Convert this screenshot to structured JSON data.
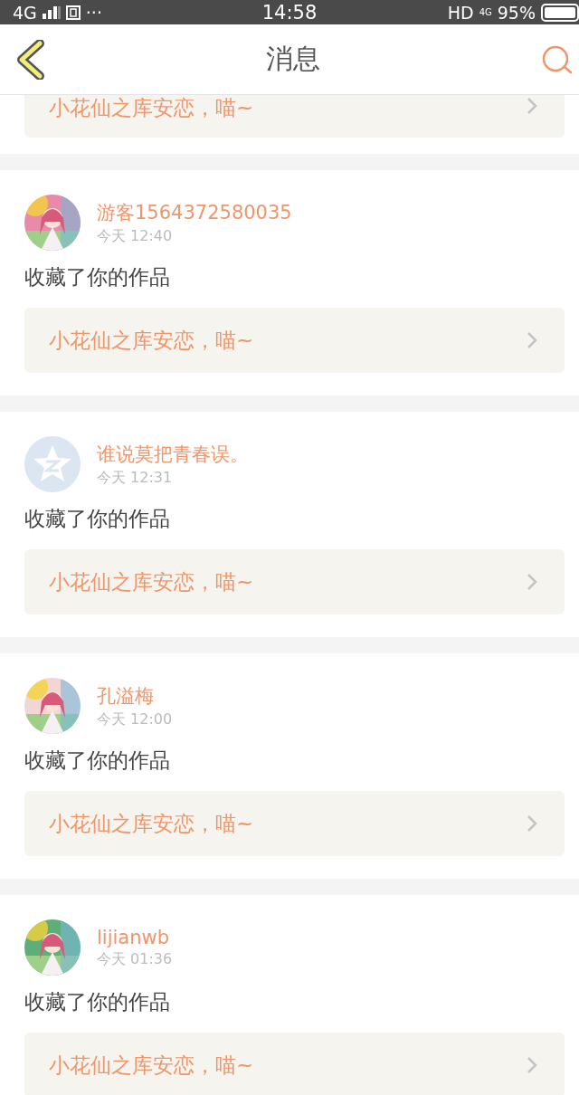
{
  "status_bar": {
    "network": "4G",
    "dots": "···",
    "time": "14:58",
    "hd": "HD",
    "network_small": "4G",
    "battery": "95%"
  },
  "header": {
    "title": "消息"
  },
  "partial_item": {
    "work_title": "小花仙之库安恋，喵~"
  },
  "messages": [
    {
      "user": "游客1564372580035",
      "time": "今天 12:40",
      "action": "收藏了你的作品",
      "work_title": "小花仙之库安恋，喵~"
    },
    {
      "user": "谁说莫把青春误。",
      "time": "今天 12:31",
      "action": "收藏了你的作品",
      "work_title": "小花仙之库安恋，喵~",
      "avatar": {
        "kind": "default"
      }
    },
    {
      "user": "孔溢梅",
      "time": "今天 12:00",
      "action": "收藏了你的作品",
      "work_title": "小花仙之库安恋，喵~"
    },
    {
      "user": "lijianwb",
      "time": "今天 01:36",
      "action": "收藏了你的作品",
      "work_title": "小花仙之库安恋，喵~"
    }
  ]
}
